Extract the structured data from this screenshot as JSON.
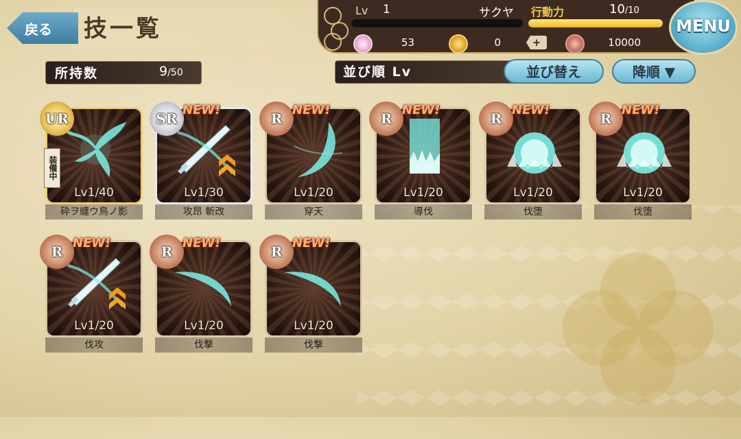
{
  "header": {
    "back_label": "戻る",
    "title": "技一覧",
    "menu_label": "MENU"
  },
  "status": {
    "lv_label": "Lv",
    "lv_value": "1",
    "player_name": "サクヤ",
    "ap_label": "行動力",
    "ap_current": "10",
    "ap_max": "/10",
    "ap_fill_fraction": 1.0,
    "currency_1": "53",
    "currency_2": "0",
    "plus_label": "+",
    "currency_3": "10000"
  },
  "inventory": {
    "count_label": "所持数",
    "count_value": "9",
    "count_max": "/50"
  },
  "sort": {
    "label": "並び順 Lv",
    "sort_button": "並び替え",
    "order_button": "降順 ▼"
  },
  "colors": {
    "accent_blue": "#6cb8d4",
    "ap_yellow": "#f0b820",
    "new_orange": "#ffb070",
    "skill_glow": "#7af0e8"
  },
  "skills": [
    {
      "name": "砕ヲ纏ウ鳥ノ影",
      "rarity": "UR",
      "lv": "Lv1",
      "lv_max": "/40",
      "new": "",
      "equipped": "装備中",
      "art": "phoenix"
    },
    {
      "name": "攻昂 斬改",
      "rarity": "SR",
      "lv": "Lv1",
      "lv_max": "/30",
      "new": "NEW!",
      "equipped": "",
      "art": "sword-up"
    },
    {
      "name": "穿天",
      "rarity": "R",
      "lv": "Lv1",
      "lv_max": "/20",
      "new": "NEW!",
      "equipped": "",
      "art": "crescent"
    },
    {
      "name": "導伐",
      "rarity": "R",
      "lv": "Lv1",
      "lv_max": "/20",
      "new": "NEW!",
      "equipped": "",
      "art": "pillar"
    },
    {
      "name": "伐堕",
      "rarity": "R",
      "lv": "Lv1",
      "lv_max": "/20",
      "new": "NEW!",
      "equipped": "",
      "art": "dome"
    },
    {
      "name": "伐堕",
      "rarity": "R",
      "lv": "Lv1",
      "lv_max": "/20",
      "new": "NEW!",
      "equipped": "",
      "art": "dome"
    },
    {
      "name": "伐攻",
      "rarity": "R",
      "lv": "Lv1",
      "lv_max": "/20",
      "new": "NEW!",
      "equipped": "",
      "art": "sword-up"
    },
    {
      "name": "伐撃",
      "rarity": "R",
      "lv": "Lv1",
      "lv_max": "/20",
      "new": "NEW!",
      "equipped": "",
      "art": "slash"
    },
    {
      "name": "伐撃",
      "rarity": "R",
      "lv": "Lv1",
      "lv_max": "/20",
      "new": "NEW!",
      "equipped": "",
      "art": "slash"
    }
  ]
}
